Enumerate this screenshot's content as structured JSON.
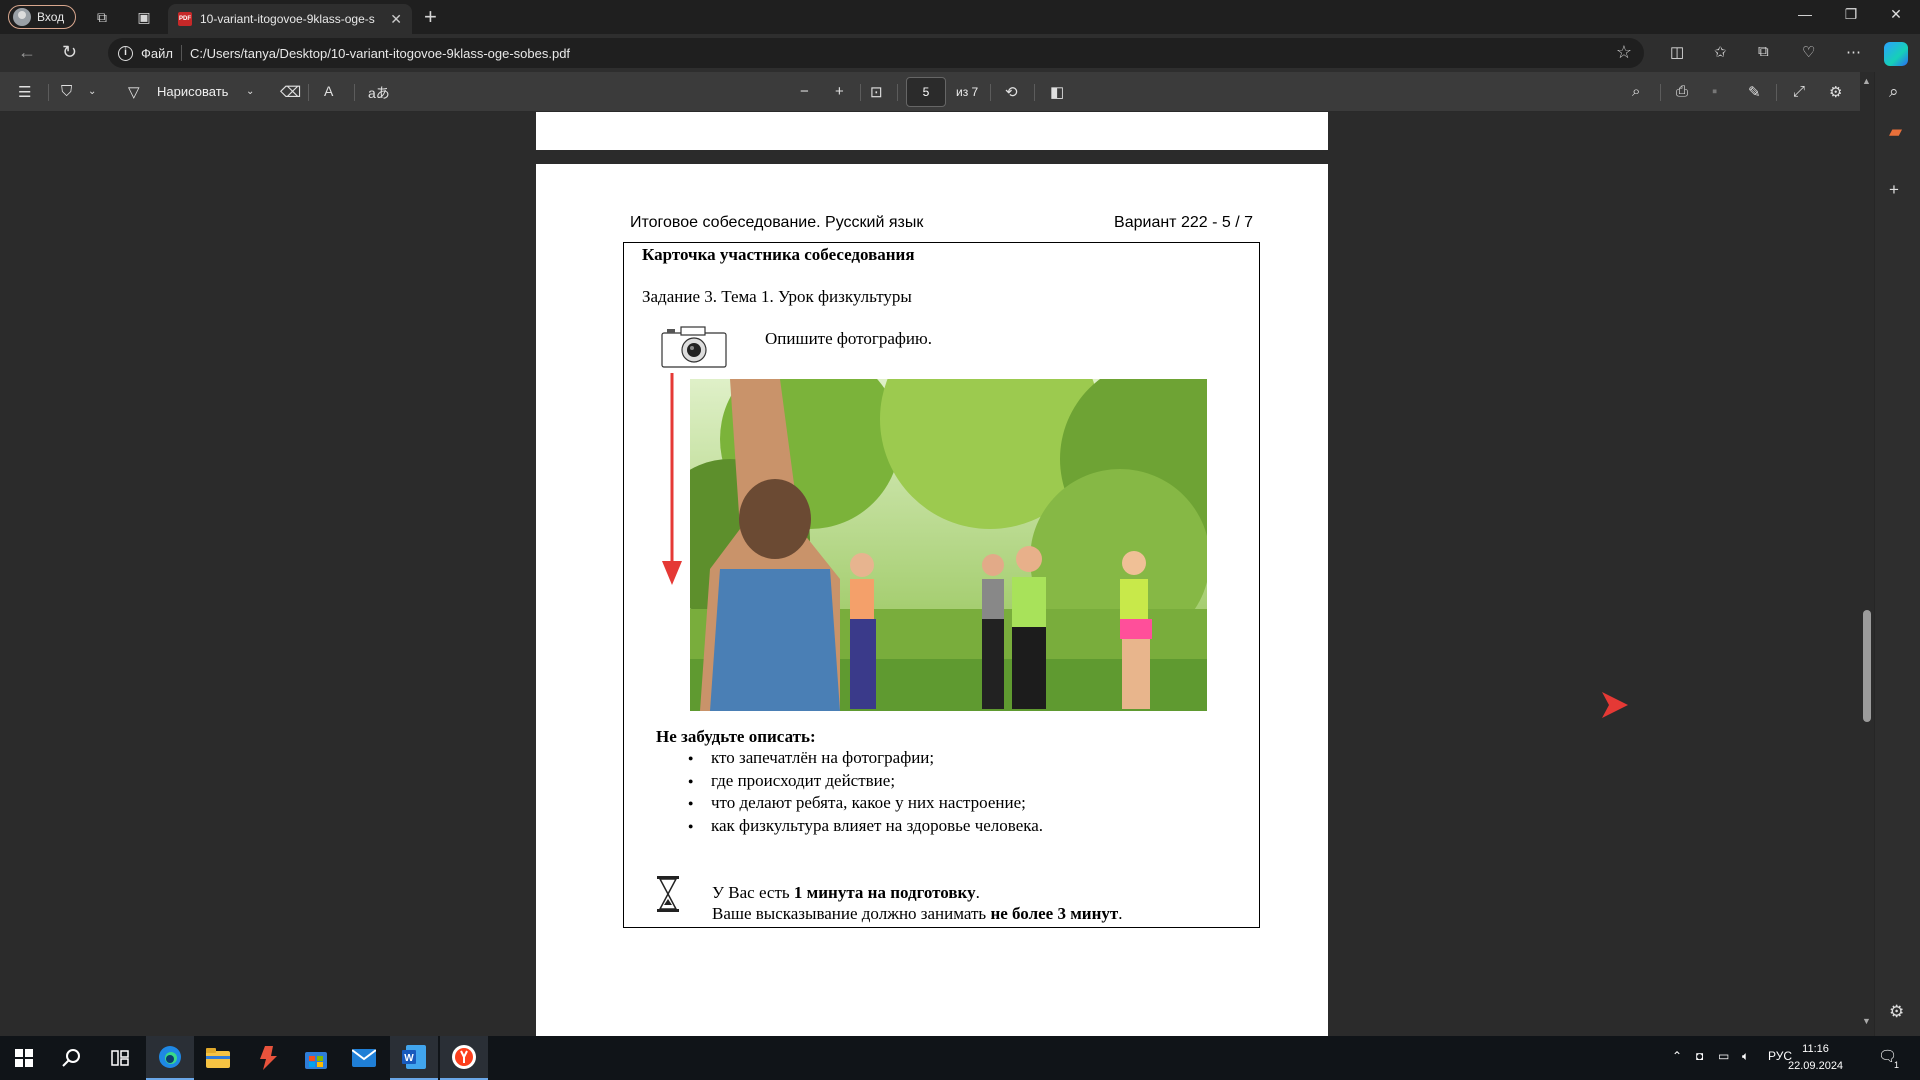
{
  "browser": {
    "profile_label": "Вход",
    "tab_title": "10-variant-itogovoe-9klass-oge-s",
    "scheme_label": "Файл",
    "url": "C:/Users/tanya/Desktop/10-variant-itogovoe-9klass-oge-sobes.pdf"
  },
  "pdf_toolbar": {
    "draw_label": "Нарисовать",
    "read_aloud_label": "A",
    "translate_label": "aあ",
    "page_number": "5",
    "page_count": "из 7"
  },
  "document": {
    "header_left": "Итоговое собеседование. Русский язык",
    "header_right": "Вариант 222 - 5 / 7",
    "card_title": "Карточка участника собеседования",
    "task_title": "Задание 3. Тема 1. Урок физкультуры",
    "describe_prompt": "Опишите фотографию.",
    "remember_label": "Не забудьте описать:",
    "bullets": [
      "кто запечатлён на фотографии;",
      "где происходит действие;",
      "что делают ребята, какое у них настроение;",
      "как физкультура влияет на здоровье человека."
    ],
    "note1_prefix": "У Вас есть ",
    "note1_bold": "1 минута на подготовку",
    "note1_suffix": ".",
    "note2_prefix": "Ваше высказывание должно занимать ",
    "note2_bold": "не более 3 минут",
    "note2_suffix": "."
  },
  "taskbar": {
    "language": "РУС",
    "time": "11:16",
    "date": "22.09.2024",
    "notification_count": "1"
  },
  "colors": {
    "annotation_red": "#e53935",
    "viewer_bg": "#2b2b2b",
    "taskbar_bg": "#101418"
  }
}
